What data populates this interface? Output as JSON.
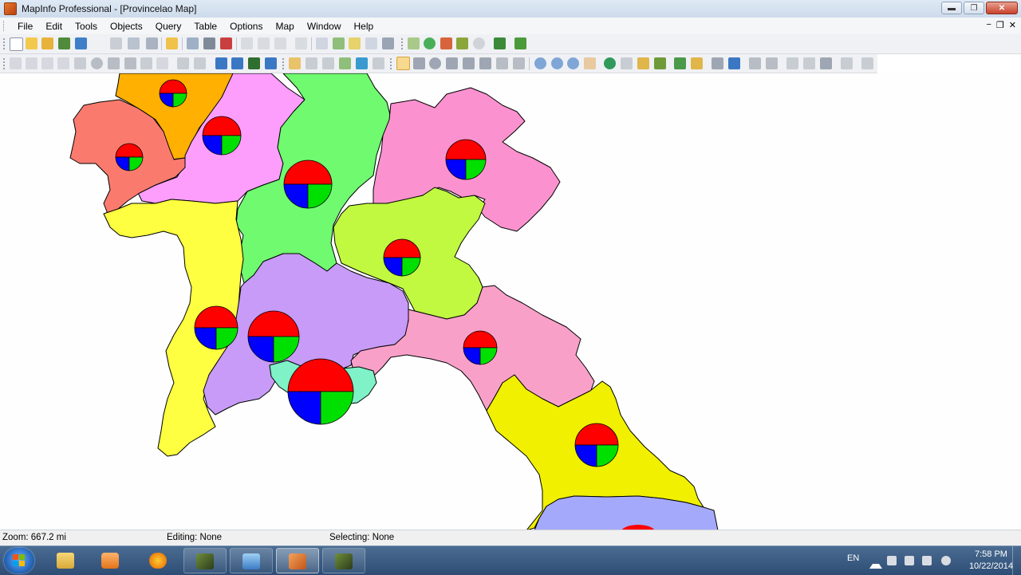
{
  "titlebar": {
    "title": "MapInfo Professional - [Provincelao Map]",
    "buttons": {
      "minimize": "▬",
      "maximize": "❐",
      "close": "✕"
    }
  },
  "menubar": {
    "items": [
      "File",
      "Edit",
      "Tools",
      "Objects",
      "Query",
      "Table",
      "Options",
      "Map",
      "Window",
      "Help"
    ],
    "mdi": {
      "minimize": "−",
      "restore": "❐",
      "close": "✕"
    }
  },
  "statusbar": {
    "zoom": "Zoom: 667.2 mi",
    "editing": "Editing: None",
    "selecting": "Selecting: None"
  },
  "taskbar": {
    "language": "EN",
    "clock_time": "7:58 PM",
    "clock_date": "10/22/2014",
    "apps": [
      "Windows Explorer",
      "Media Player",
      "Firefox",
      "MapInfo",
      "Remote Desktop",
      "MapInfo Professional",
      "MapInfo Tool"
    ]
  },
  "map": {
    "pie_colors": {
      "series_a": "#ff0000",
      "series_b": "#0000ff",
      "series_c": "#00e000"
    },
    "province_colors": [
      "#ffb000",
      "#fd9efd",
      "#fa7b6e",
      "#70fa70",
      "#fb92cf",
      "#c0f940",
      "#feff40",
      "#c79bf7",
      "#f9a0c9",
      "#f0f000",
      "#7ff2c8",
      "#a5a9fb"
    ]
  }
}
